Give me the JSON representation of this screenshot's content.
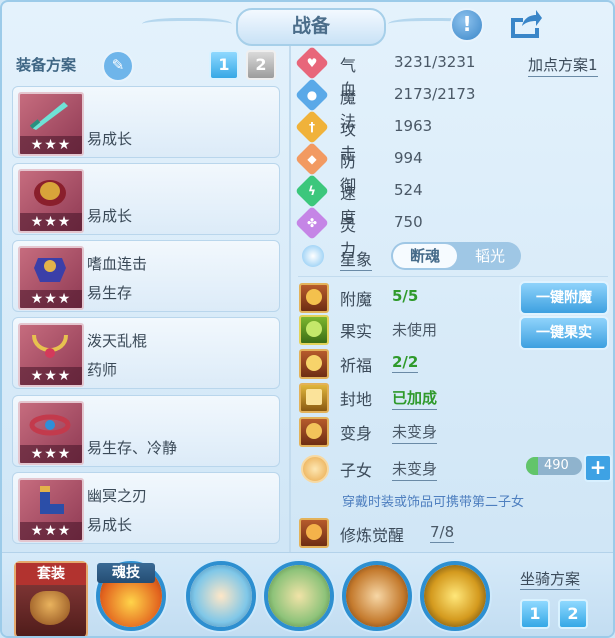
{
  "window": {
    "title": "战备"
  },
  "left": {
    "heading": "装备方案",
    "scheme_buttons": [
      "1",
      "2"
    ],
    "items": [
      {
        "name": "",
        "attr": "易成长",
        "stars": "★★★"
      },
      {
        "name": "",
        "attr": "易成长",
        "stars": "★★★"
      },
      {
        "name": "嗜血连击",
        "attr": "易生存",
        "stars": "★★★"
      },
      {
        "name": "泼天乱棍",
        "attr": "药师",
        "stars": "★★★"
      },
      {
        "name": "",
        "attr": "易生存、冷静",
        "stars": "★★★"
      },
      {
        "name": "幽冥之刃",
        "attr": "易成长",
        "stars": "★★★"
      }
    ]
  },
  "stats": {
    "plan_link": "加点方案1",
    "rows": [
      {
        "label": "气血",
        "value": "3231/3231",
        "icon": "heart-icon",
        "color": "#e8667a"
      },
      {
        "label": "魔法",
        "value": "2173/2173",
        "icon": "mana-icon",
        "color": "#5aa9e8"
      },
      {
        "label": "攻击",
        "value": "1963",
        "icon": "sword-icon",
        "color": "#f0b23a"
      },
      {
        "label": "防御",
        "value": "994",
        "icon": "shield-icon",
        "color": "#f29a62"
      },
      {
        "label": "速度",
        "value": "524",
        "icon": "speed-icon",
        "color": "#3cc77c"
      },
      {
        "label": "灵力",
        "value": "750",
        "icon": "spirit-icon",
        "color": "#c585e6"
      }
    ],
    "star_label": "星象",
    "star_toggle": {
      "on": "断魂",
      "off": "韬光"
    }
  },
  "enhance": {
    "rows": [
      {
        "label": "附魔",
        "value": "5/5",
        "icon": "enchant-icon"
      },
      {
        "label": "果实",
        "value": "未使用",
        "icon": "fruit-icon"
      },
      {
        "label": "祈福",
        "value": "2/2",
        "icon": "blessing-icon"
      },
      {
        "label": "封地",
        "value": "已加成",
        "icon": "fief-icon"
      },
      {
        "label": "变身",
        "value": "未变身",
        "icon": "transform-icon"
      },
      {
        "label": "子女",
        "value": "未变身",
        "icon": "child-icon"
      }
    ],
    "btn_enchant": "一键附魔",
    "btn_fruit": "一键果实",
    "child_value": "490",
    "child_note": "穿戴时装或饰品可携带第二子女",
    "cultivation": {
      "label": "修炼觉醒",
      "value": "7/8"
    }
  },
  "bottom": {
    "suit_label": "套装",
    "soul_label": "魂技",
    "mount_label": "坐骑方案",
    "mount_buttons": [
      "1",
      "2"
    ]
  }
}
